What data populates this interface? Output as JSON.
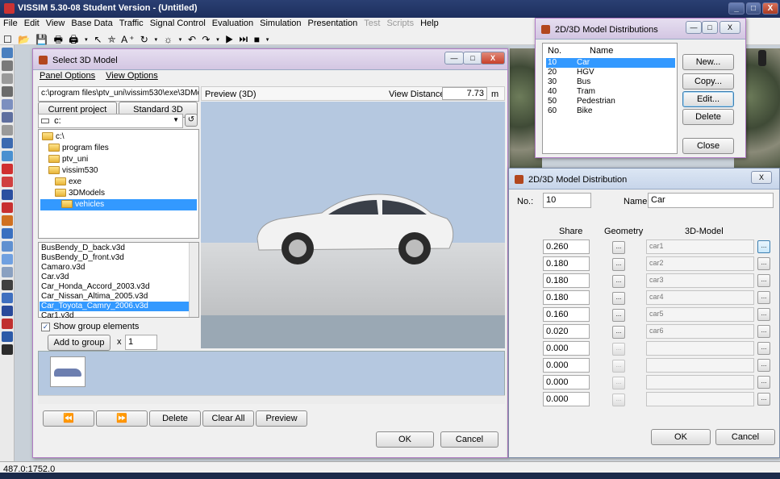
{
  "main_window": {
    "title": "VISSIM 5.30-08 Student Version - (Untitled)",
    "controls": [
      "_",
      "□",
      "X"
    ]
  },
  "menu": [
    {
      "label": "File",
      "enabled": true
    },
    {
      "label": "Edit",
      "enabled": true
    },
    {
      "label": "View",
      "enabled": true
    },
    {
      "label": "Base Data",
      "enabled": true
    },
    {
      "label": "Traffic",
      "enabled": true
    },
    {
      "label": "Signal Control",
      "enabled": true
    },
    {
      "label": "Evaluation",
      "enabled": true
    },
    {
      "label": "Simulation",
      "enabled": true
    },
    {
      "label": "Presentation",
      "enabled": true
    },
    {
      "label": "Test",
      "enabled": false
    },
    {
      "label": "Scripts",
      "enabled": false
    },
    {
      "label": "Help",
      "enabled": true
    }
  ],
  "toolbar_text": "☐ 📂 💾 🖶 🖨 ▾ ↖ ⛤ A⁺ ↻ ▾ ☼ ▾ ↶ ↷ ▾ ▶ ⏭ ■ ▾",
  "status_text": "487.0:1752.0",
  "select_model": {
    "title": "Select 3D Model",
    "menu": [
      "Panel Options",
      "View Options"
    ],
    "path": "c:\\program files\\ptv_uni\\vissim530\\exe\\3DMode",
    "current_project_label": "Current project",
    "standard_models_label": "Standard 3D Models",
    "drive": "c:",
    "tree": [
      {
        "label": "c:\\",
        "indent": 0,
        "selected": false
      },
      {
        "label": "program files",
        "indent": 1,
        "selected": false
      },
      {
        "label": "ptv_uni",
        "indent": 1,
        "selected": false
      },
      {
        "label": "vissim530",
        "indent": 1,
        "selected": false
      },
      {
        "label": "exe",
        "indent": 2,
        "selected": false
      },
      {
        "label": "3DModels",
        "indent": 2,
        "selected": false
      },
      {
        "label": "vehicles",
        "indent": 3,
        "selected": true
      }
    ],
    "files": [
      {
        "label": "BusBendy_D_back.v3d",
        "selected": false
      },
      {
        "label": "BusBendy_D_front.v3d",
        "selected": false
      },
      {
        "label": "Camaro.v3d",
        "selected": false
      },
      {
        "label": "Car.v3d",
        "selected": false
      },
      {
        "label": "Car_Honda_Accord_2003.v3d",
        "selected": false
      },
      {
        "label": "Car_Nissan_Altima_2005.v3d",
        "selected": false
      },
      {
        "label": "Car_Toyota_Camry_2006.v3d",
        "selected": true
      },
      {
        "label": "Car1.v3d",
        "selected": false
      }
    ],
    "show_group_label": "Show group elements",
    "show_group_checked": true,
    "add_group_label": "Add to group",
    "times_label": "x",
    "count": "1",
    "preview_label": "Preview (3D)",
    "view_distance_label": "View Distance:",
    "view_distance": "7.73",
    "view_distance_unit": "m",
    "buttons": {
      "first": "⏪",
      "last": "⏩",
      "delete": "Delete",
      "clear_all": "Clear All",
      "preview": "Preview",
      "ok": "OK",
      "cancel": "Cancel"
    }
  },
  "distributions": {
    "title": "2D/3D Model Distributions",
    "col_no": "No.",
    "col_name": "Name",
    "rows": [
      {
        "no": "10",
        "name": "Car",
        "selected": true
      },
      {
        "no": "20",
        "name": "HGV",
        "selected": false
      },
      {
        "no": "30",
        "name": "Bus",
        "selected": false
      },
      {
        "no": "40",
        "name": "Tram",
        "selected": false
      },
      {
        "no": "50",
        "name": "Pedestrian",
        "selected": false
      },
      {
        "no": "60",
        "name": "Bike",
        "selected": false
      }
    ],
    "buttons": {
      "new": "New...",
      "copy": "Copy...",
      "edit": "Edit...",
      "delete": "Delete",
      "close": "Close"
    }
  },
  "distribution": {
    "title": "2D/3D Model Distribution",
    "no_label": "No.:",
    "no_value": "10",
    "name_label": "Name:",
    "name_value": "Car",
    "col_share": "Share",
    "col_geometry": "Geometry",
    "col_model": "3D-Model",
    "ellipsis": "...",
    "rows": [
      {
        "share": "0.260",
        "model": "car1",
        "active": true
      },
      {
        "share": "0.180",
        "model": "car2",
        "active": true
      },
      {
        "share": "0.180",
        "model": "car3",
        "active": true
      },
      {
        "share": "0.180",
        "model": "car4",
        "active": true
      },
      {
        "share": "0.160",
        "model": "car5",
        "active": true
      },
      {
        "share": "0.020",
        "model": "car6",
        "active": true
      },
      {
        "share": "0.000",
        "model": "",
        "active": false
      },
      {
        "share": "0.000",
        "model": "",
        "active": false
      },
      {
        "share": "0.000",
        "model": "",
        "active": false
      },
      {
        "share": "0.000",
        "model": "",
        "active": false
      }
    ],
    "ok": "OK",
    "cancel": "Cancel"
  },
  "colors": {
    "selection": "#3399ff",
    "preview_sky": "#b5c8e0",
    "preview_ground": "#c4c6c8"
  }
}
